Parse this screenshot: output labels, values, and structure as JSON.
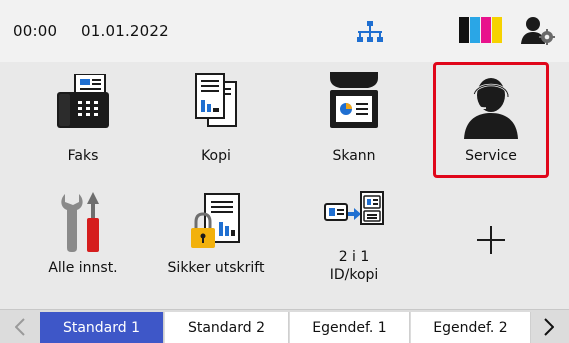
{
  "status_bar": {
    "time": "00:00",
    "date": "01.01.2022",
    "icons": [
      "network-icon",
      "ink-level-icon",
      "admin-settings-icon"
    ],
    "ink_colors": [
      "#111111",
      "#2aa6e6",
      "#e8128c",
      "#f6d200"
    ]
  },
  "tiles": [
    {
      "label": "Faks",
      "icon": "fax-icon"
    },
    {
      "label": "Kopi",
      "icon": "copy-icon"
    },
    {
      "label": "Skann",
      "icon": "scan-icon"
    },
    {
      "label": "Service",
      "icon": "headset-person-icon",
      "highlighted": true
    },
    {
      "label": "Alle innst.",
      "icon": "tools-icon"
    },
    {
      "label": "Sikker utskrift",
      "icon": "secure-print-icon"
    },
    {
      "label_line1": "2 i 1",
      "label_line2": "ID/kopi",
      "icon": "id-copy-icon"
    },
    {
      "label": "",
      "icon": "plus-icon"
    }
  ],
  "tabs": [
    {
      "label": "Standard 1",
      "active": true
    },
    {
      "label": "Standard 2"
    },
    {
      "label": "Egendef. 1"
    },
    {
      "label": "Egendef. 2"
    }
  ],
  "colors": {
    "accent_tab": "#3e57c8",
    "highlight_border": "#e0061a",
    "icon_blue": "#1f6fd1",
    "icon_dark": "#1b1b1b",
    "background": "#e9e9e9"
  }
}
